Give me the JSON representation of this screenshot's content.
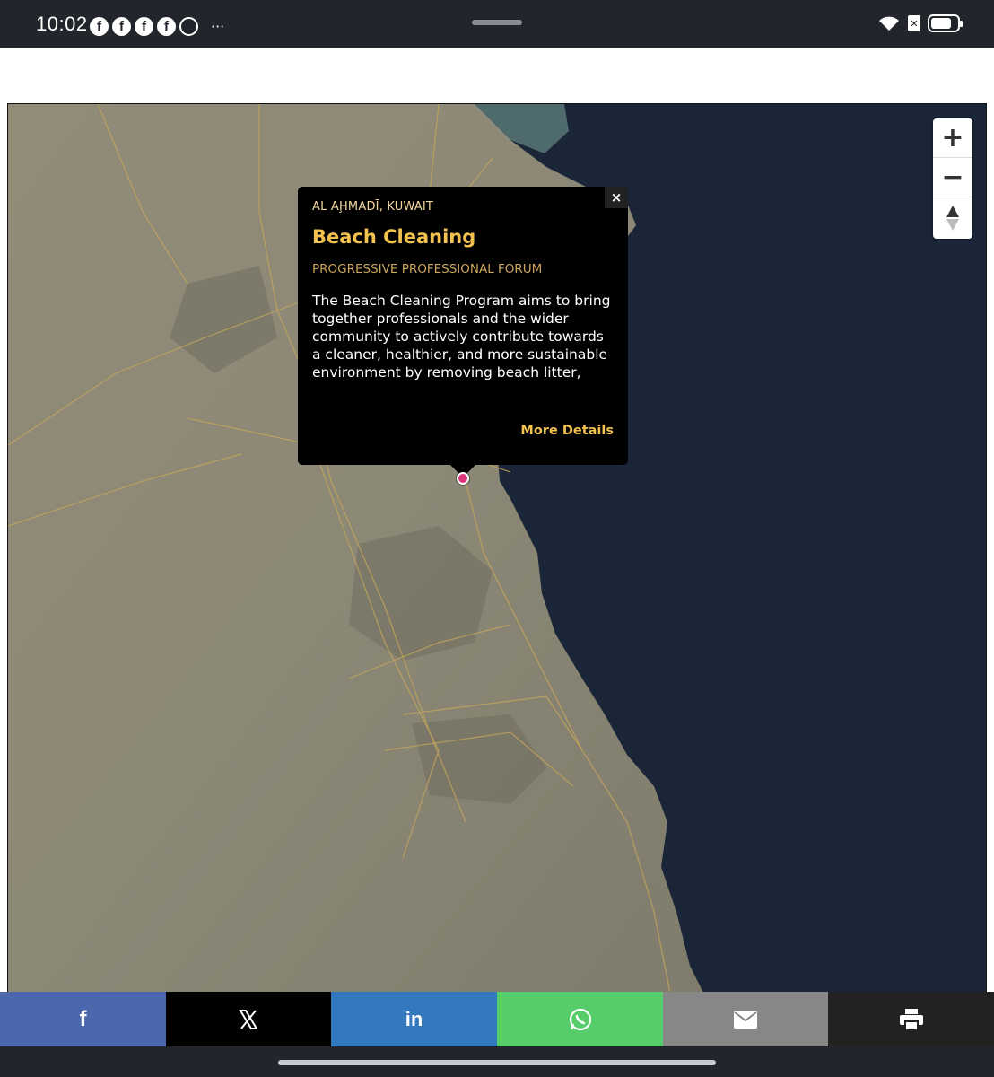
{
  "status_bar": {
    "time": "10:02",
    "notification_icons": [
      "facebook-icon",
      "facebook-icon",
      "facebook-icon",
      "facebook-icon",
      "whatsapp-icon"
    ],
    "more_indicator": "···",
    "right_icons": [
      "wifi-icon",
      "sim-disabled-icon",
      "battery-icon"
    ],
    "fb_glyph": "f",
    "sim_glyph": "✕"
  },
  "map": {
    "zoom_in_label": "+",
    "zoom_out_label": "−",
    "reset_north_label": "▲",
    "marker_color": "#e0357a",
    "sea_color": "#1b2538",
    "land_color": "#8f8b79"
  },
  "popup": {
    "location": "AL AḨMADĪ, KUWAIT",
    "title": "Beach Cleaning",
    "organization": "PROGRESSIVE PROFESSIONAL FORUM",
    "description": "The Beach Cleaning Program aims to bring together professionals and the wider community to actively contribute towards a cleaner, healthier, and more sustainable environment by removing beach litter,",
    "more_details": "More Details",
    "close_label": "×",
    "title_color": "#f2c14e"
  },
  "share_bar": {
    "buttons": [
      {
        "name": "facebook",
        "icon": "facebook-icon",
        "color": "#4b67ad"
      },
      {
        "name": "x",
        "icon": "x-icon",
        "color": "#000000"
      },
      {
        "name": "linkedin",
        "icon": "linkedin-icon",
        "color": "#3379bd"
      },
      {
        "name": "whatsapp",
        "icon": "whatsapp-icon",
        "color": "#57cc6b"
      },
      {
        "name": "email",
        "icon": "mail-icon",
        "color": "#878787"
      },
      {
        "name": "print",
        "icon": "printer-icon",
        "color": "#222222"
      }
    ],
    "facebook_glyph": "f",
    "linkedin_glyph": "in"
  }
}
